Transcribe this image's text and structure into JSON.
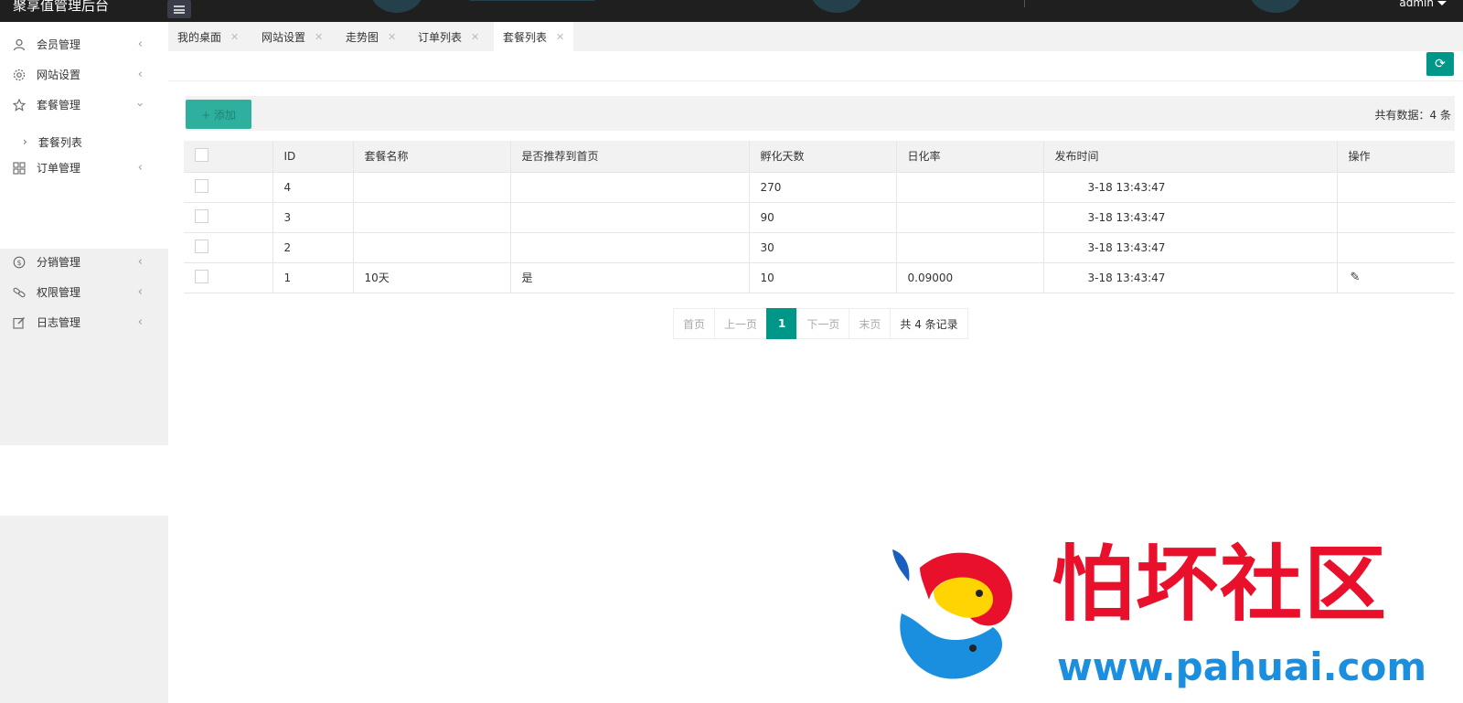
{
  "header": {
    "app_title": "聚享值管理后台",
    "user": "admin"
  },
  "sidebar": {
    "items": [
      {
        "label": "会员管理",
        "icon": "user-icon"
      },
      {
        "label": "网站设置",
        "icon": "gear-icon"
      },
      {
        "label": "套餐管理",
        "icon": "star-icon"
      },
      {
        "label": "订单管理",
        "icon": "grid-icon"
      },
      {
        "label": "分销管理",
        "icon": "coin-icon"
      },
      {
        "label": "权限管理",
        "icon": "link-icon"
      },
      {
        "label": "日志管理",
        "icon": "edit-icon"
      }
    ],
    "sub_item": {
      "label": "套餐列表"
    }
  },
  "tabs": [
    {
      "label": "我的桌面"
    },
    {
      "label": "网站设置"
    },
    {
      "label": "走势图"
    },
    {
      "label": "订单列表"
    },
    {
      "label": "套餐列表"
    }
  ],
  "toolbar": {
    "add_label": "+ 添加",
    "count_text": "共有数据：4 条"
  },
  "table": {
    "headers": [
      "",
      "ID",
      "套餐名称",
      "是否推荐到首页",
      "孵化天数",
      "日化率",
      "发布时间",
      "操作"
    ],
    "rows": [
      {
        "id": "4",
        "name": "",
        "recommend": "",
        "days": "270",
        "rate": "",
        "time": "3-18 13:43:47"
      },
      {
        "id": "3",
        "name": "",
        "recommend": "",
        "days": "90",
        "rate": "",
        "time": "3-18 13:43:47"
      },
      {
        "id": "2",
        "name": "",
        "recommend": "",
        "days": "30",
        "rate": "",
        "time": "3-18 13:43:47"
      },
      {
        "id": "1",
        "name": "10天",
        "recommend": "是",
        "days": "10",
        "rate": "0.09000",
        "time": "3-18 13:43:47"
      }
    ]
  },
  "pagination": {
    "first": "首页",
    "prev": "上一页",
    "current": "1",
    "next": "下一页",
    "last": "末页",
    "total": "共 4 条记录"
  },
  "watermark": {
    "title": "怕坏社区",
    "url": "www.pahuai.com"
  },
  "colors": {
    "accent": "#009688",
    "topbar": "#1f1f1f",
    "watermark_red": "#e8102a",
    "watermark_blue": "#1a8fe0"
  }
}
